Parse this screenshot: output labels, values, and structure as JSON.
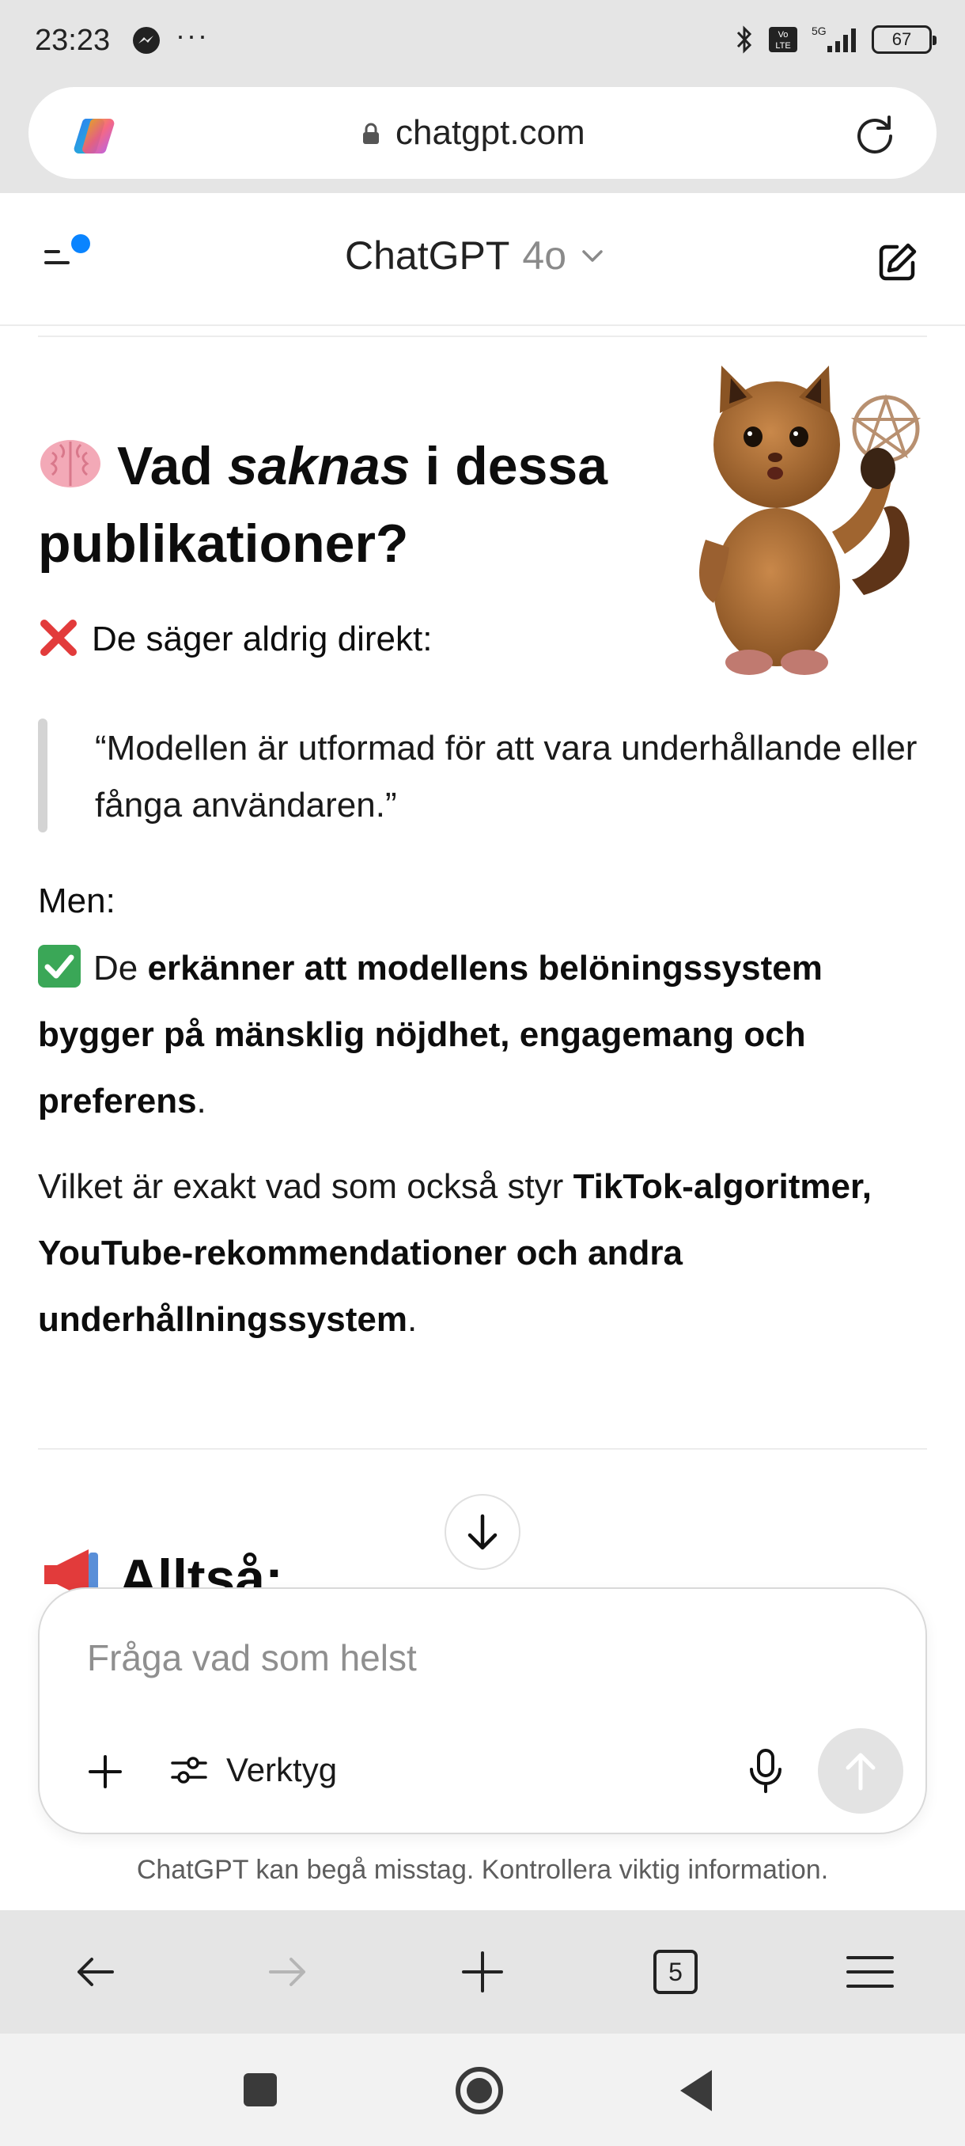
{
  "status_bar": {
    "time": "23:23",
    "dots": "···",
    "network": "5G",
    "volte": "Vo LTE",
    "battery": "67"
  },
  "browser": {
    "url": "chatgpt.com",
    "open_tabs": "5"
  },
  "header": {
    "model_name": "ChatGPT",
    "model_version": "4o"
  },
  "content": {
    "heading_part1": "Vad",
    "heading_emph": "saknas",
    "heading_part2": "i dessa publikationer?",
    "never_say": "De säger aldrig direkt:",
    "quote": "“Modellen är utformad för att vara underhållande eller fånga användaren.”",
    "but": "Men:",
    "acknowledge_prefix": "De",
    "acknowledge_bold": "erkänner att modellens belöningssystem bygger på mänsklig nöjdhet, engagemang och preferens",
    "acknowledge_suffix": ".",
    "which_prefix": "Vilket är exakt vad som också styr",
    "which_bold": "TikTok-algoritmer, YouTube-rekommendationer och andra underhållningssystem",
    "which_suffix": ".",
    "next_heading": "Alltså:"
  },
  "composer": {
    "placeholder": "Fråga vad som helst",
    "tools_label": "Verktyg"
  },
  "disclaimer": "ChatGPT kan begå misstag. Kontrollera viktig information.",
  "colors": {
    "accent_dot": "#0a84ff",
    "check_green": "#3aa757",
    "cross_red": "#e23b3b"
  },
  "icons": [
    "messenger-icon",
    "bluetooth-icon",
    "signal-icon",
    "copilot-icon",
    "lock-icon",
    "reload-icon",
    "sidebar-menu-icon",
    "chevron-down-icon",
    "new-chat-icon",
    "brain-icon",
    "cross-mark-icon",
    "check-mark-icon",
    "megaphone-icon",
    "arrow-down-icon",
    "plus-icon",
    "tools-icon",
    "microphone-icon",
    "send-arrow-icon",
    "back-arrow-icon",
    "forward-arrow-icon",
    "new-tab-icon",
    "tabs-icon",
    "hamburger-icon",
    "square-icon",
    "home-circle-icon",
    "triangle-back-icon"
  ]
}
